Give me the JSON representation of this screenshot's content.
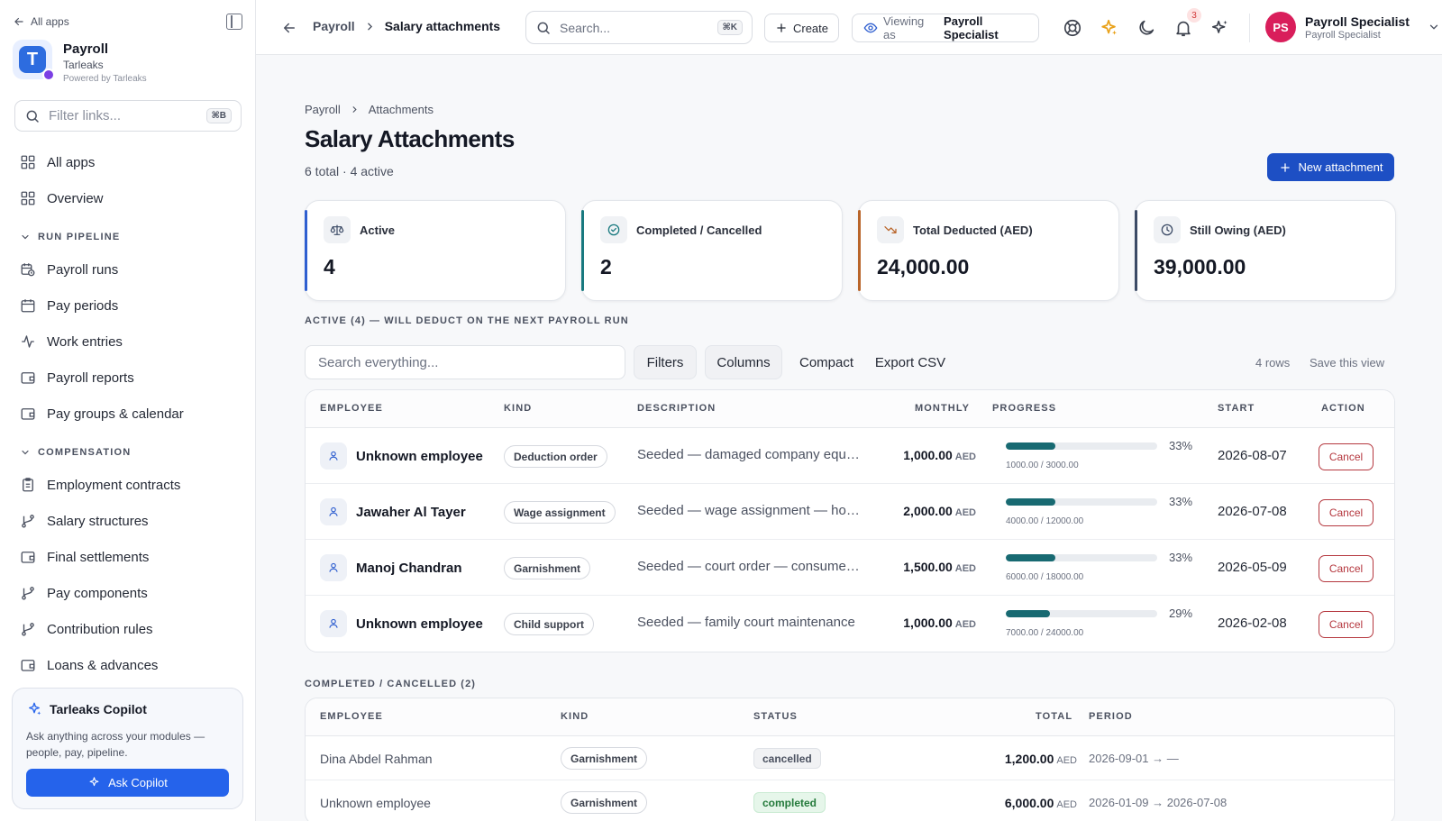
{
  "sidebar": {
    "all_apps_link": "All apps",
    "brand": {
      "name": "Payroll",
      "org": "Tarleaks",
      "powered": "Powered by Tarleaks",
      "logo_letter": "T"
    },
    "filter": {
      "placeholder": "Filter links...",
      "shortcut": "⌘B"
    },
    "top_items": [
      {
        "label": "All apps",
        "icon": "grid-icon"
      },
      {
        "label": "Overview",
        "icon": "grid-icon"
      }
    ],
    "sections": [
      {
        "title": "RUN PIPELINE",
        "items": [
          {
            "label": "Payroll runs",
            "icon": "calendar-clock-icon"
          },
          {
            "label": "Pay periods",
            "icon": "calendar-icon"
          },
          {
            "label": "Work entries",
            "icon": "activity-icon"
          },
          {
            "label": "Payroll reports",
            "icon": "wallet-icon"
          },
          {
            "label": "Pay groups & calendar",
            "icon": "wallet-icon"
          }
        ]
      },
      {
        "title": "COMPENSATION",
        "items": [
          {
            "label": "Employment contracts",
            "icon": "clipboard-icon"
          },
          {
            "label": "Salary structures",
            "icon": "branch-icon"
          },
          {
            "label": "Final settlements",
            "icon": "wallet-icon"
          },
          {
            "label": "Pay components",
            "icon": "branch-icon"
          },
          {
            "label": "Contribution rules",
            "icon": "branch-icon"
          },
          {
            "label": "Loans & advances",
            "icon": "wallet-icon"
          }
        ]
      }
    ],
    "copilot": {
      "title": "Tarleaks Copilot",
      "description": "Ask anything across your modules — people, pay, pipeline.",
      "button": "Ask Copilot"
    }
  },
  "topbar": {
    "breadcrumb": [
      "Payroll",
      "Salary attachments"
    ],
    "search": {
      "placeholder": "Search...",
      "shortcut": "⌘K"
    },
    "create_label": "Create",
    "viewing_prefix": "Viewing as",
    "viewing_role": "Payroll Specialist",
    "notification_count": "3",
    "user": {
      "initials": "PS",
      "name": "Payroll Specialist",
      "role": "Payroll Specialist"
    }
  },
  "page": {
    "breadcrumb": [
      "Payroll",
      "Attachments"
    ],
    "title": "Salary Attachments",
    "subtitle": "6 total · 4 active",
    "new_button": "New attachment"
  },
  "stats": [
    {
      "label": "Active",
      "value": "4",
      "icon": "scale-icon",
      "accent": "#2f5fd0"
    },
    {
      "label": "Completed / Cancelled",
      "value": "2",
      "icon": "check-circle-icon",
      "accent": "#18797f"
    },
    {
      "label": "Total Deducted (AED)",
      "value": "24,000.00",
      "icon": "trending-down-icon",
      "accent": "#b9652a"
    },
    {
      "label": "Still Owing (AED)",
      "value": "39,000.00",
      "icon": "clock-icon",
      "accent": "#3c4b66"
    }
  ],
  "active_section": {
    "label": "ACTIVE (4) — WILL DEDUCT ON THE NEXT PAYROLL RUN",
    "search_placeholder": "Search everything...",
    "buttons": {
      "filters": "Filters",
      "columns": "Columns",
      "compact": "Compact",
      "export": "Export CSV"
    },
    "rows_count": "4 rows",
    "save_view": "Save this view",
    "columns": [
      "EMPLOYEE",
      "KIND",
      "DESCRIPTION",
      "MONTHLY",
      "PROGRESS",
      "START",
      "ACTION"
    ],
    "rows": [
      {
        "employee": "Unknown employee",
        "kind": "Deduction order",
        "description": "Seeded — damaged company equipment",
        "monthly": "1,000.00",
        "currency": "AED",
        "progress": 0.33,
        "pct": "33%",
        "amounts": "1000.00 / 3000.00",
        "start": "2026-08-07",
        "action": "Cancel"
      },
      {
        "employee": "Jawaher Al Tayer",
        "kind": "Wage assignment",
        "description": "Seeded — wage assignment — housing",
        "monthly": "2,000.00",
        "currency": "AED",
        "progress": 0.33,
        "pct": "33%",
        "amounts": "4000.00 / 12000.00",
        "start": "2026-07-08",
        "action": "Cancel"
      },
      {
        "employee": "Manoj Chandran",
        "kind": "Garnishment",
        "description": "Seeded — court order — consumer debt",
        "monthly": "1,500.00",
        "currency": "AED",
        "progress": 0.33,
        "pct": "33%",
        "amounts": "6000.00 / 18000.00",
        "start": "2026-05-09",
        "action": "Cancel"
      },
      {
        "employee": "Unknown employee",
        "kind": "Child support",
        "description": "Seeded — family court maintenance",
        "monthly": "1,000.00",
        "currency": "AED",
        "progress": 0.29,
        "pct": "29%",
        "amounts": "7000.00 / 24000.00",
        "start": "2026-02-08",
        "action": "Cancel"
      }
    ]
  },
  "done_section": {
    "label": "COMPLETED / CANCELLED (2)",
    "columns": [
      "EMPLOYEE",
      "KIND",
      "STATUS",
      "TOTAL",
      "PERIOD"
    ],
    "rows": [
      {
        "employee": "Dina Abdel Rahman",
        "kind": "Garnishment",
        "status": "cancelled",
        "total": "1,200.00",
        "currency": "AED",
        "period": "2026-09-01 → —"
      },
      {
        "employee": "Unknown employee",
        "kind": "Garnishment",
        "status": "completed",
        "total": "6,000.00",
        "currency": "AED",
        "period": "2026-01-09 → 2026-07-08"
      }
    ]
  }
}
